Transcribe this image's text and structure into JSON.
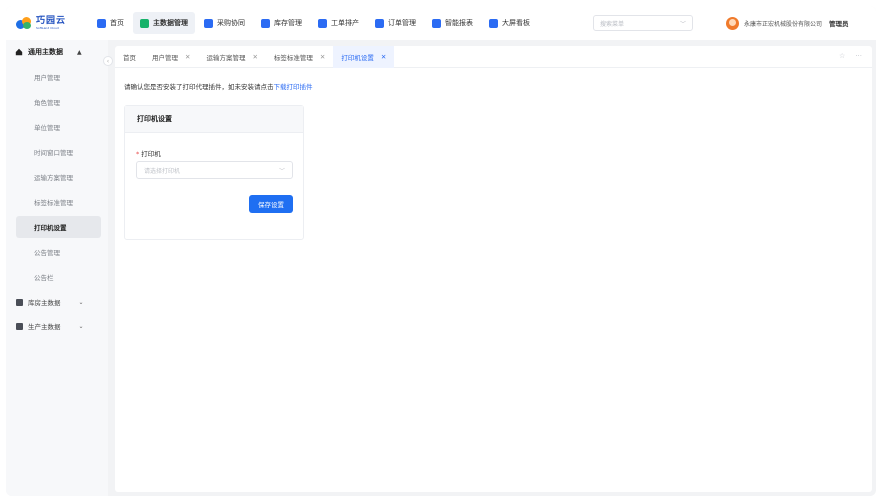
{
  "logo": {
    "name": "巧园云",
    "sub": "SoftLand Cloud"
  },
  "nav": [
    {
      "label": "首页",
      "icon": "home-icon",
      "color": "#2b6bf3"
    },
    {
      "label": "主数据管理",
      "icon": "database-icon",
      "color": "#17b26a",
      "active": true
    },
    {
      "label": "采购协同",
      "icon": "purchase-icon",
      "color": "#2b6bf3"
    },
    {
      "label": "库存管理",
      "icon": "inventory-icon",
      "color": "#2b6bf3"
    },
    {
      "label": "工单排产",
      "icon": "workorder-icon",
      "color": "#2b6bf3"
    },
    {
      "label": "订单管理",
      "icon": "order-icon",
      "color": "#2b6bf3"
    },
    {
      "label": "智能报表",
      "icon": "report-icon",
      "color": "#2b6bf3"
    },
    {
      "label": "大屏看板",
      "icon": "dashboard-icon",
      "color": "#2b6bf3"
    }
  ],
  "search": {
    "placeholder": "搜索菜单"
  },
  "user": {
    "company": "永康市正宏机械股份有限公司",
    "role": "管理员"
  },
  "sidebar": {
    "header": "通用主数据",
    "items": [
      {
        "label": "用户管理"
      },
      {
        "label": "角色管理"
      },
      {
        "label": "单位管理"
      },
      {
        "label": "时间窗口管理"
      },
      {
        "label": "运输方案管理"
      },
      {
        "label": "标签标准管理"
      },
      {
        "label": "打印机设置",
        "active": true
      },
      {
        "label": "公告管理"
      },
      {
        "label": "公告栏"
      }
    ],
    "groups": [
      {
        "label": "库房主数据"
      },
      {
        "label": "生产主数据"
      }
    ]
  },
  "tabs": [
    {
      "label": "首页",
      "closable": false
    },
    {
      "label": "用户管理",
      "closable": true
    },
    {
      "label": "运输方案管理",
      "closable": true
    },
    {
      "label": "标签标准管理",
      "closable": true
    },
    {
      "label": "打印机设置",
      "closable": true,
      "active": true
    }
  ],
  "notice": {
    "text": "请确认您是否安装了打印代理插件，如未安装请点击",
    "link": "下载打印插件"
  },
  "card": {
    "title": "打印机设置",
    "field_label": "打印机",
    "select_placeholder": "请选择打印机",
    "save_label": "保存设置"
  },
  "colors": {
    "accent": "#2b6bf3",
    "primary_button": "#1f6ff2",
    "required": "#e84b4b"
  }
}
